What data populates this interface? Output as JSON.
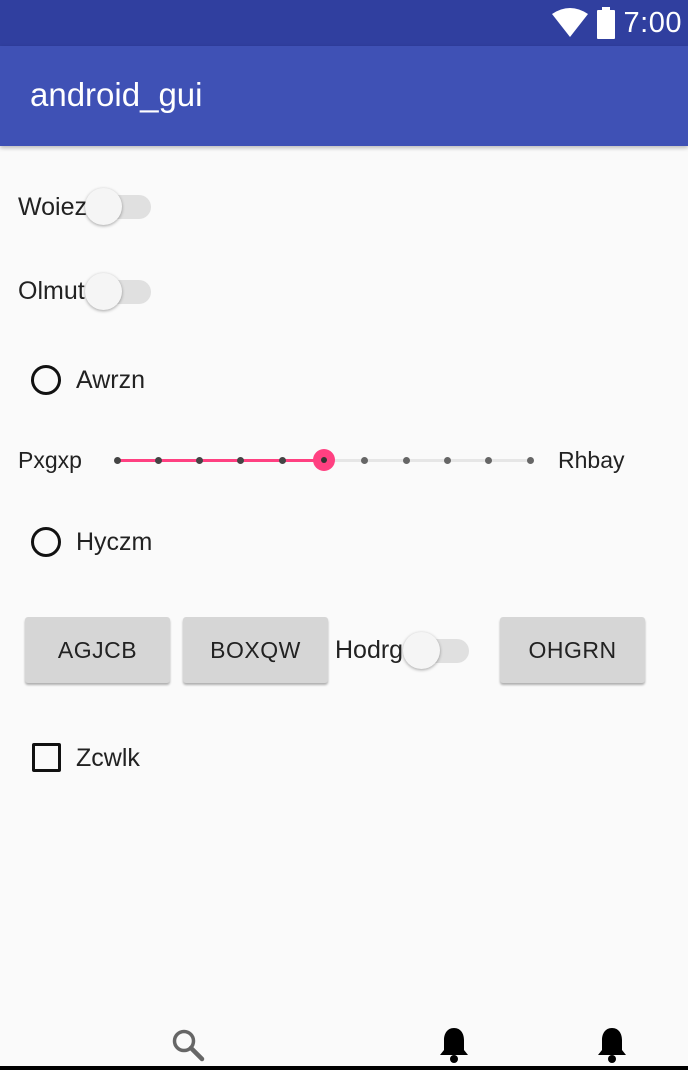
{
  "status_bar": {
    "time": "7:00",
    "wifi_icon": "wifi-icon",
    "battery_icon": "battery-icon"
  },
  "app_bar": {
    "title": "android_gui"
  },
  "main": {
    "switch1": {
      "label": "Woiez",
      "checked": false
    },
    "switch2": {
      "label": "Olmut",
      "checked": false
    },
    "radio1": {
      "label": "Awrzn",
      "checked": false
    },
    "slider": {
      "left_label": "Pxgxp",
      "right_label": "Rhbay",
      "steps": 10,
      "value": 5,
      "accent": "#ff4081"
    },
    "radio2": {
      "label": "Hyczm",
      "checked": false
    },
    "button_row": {
      "button1": "AGJCB",
      "button2": "BOXQW",
      "switch_label": "Hodrg",
      "switch_checked": false,
      "button3": "OHGRN"
    },
    "checkbox1": {
      "label": "Zcwlk",
      "checked": false
    }
  },
  "bottom_nav": {
    "icons": [
      "search-icon",
      "bell-icon",
      "bell-icon"
    ]
  },
  "colors": {
    "status_bar": "#303f9f",
    "app_bar": "#3f51b5",
    "background": "#fafafa"
  }
}
